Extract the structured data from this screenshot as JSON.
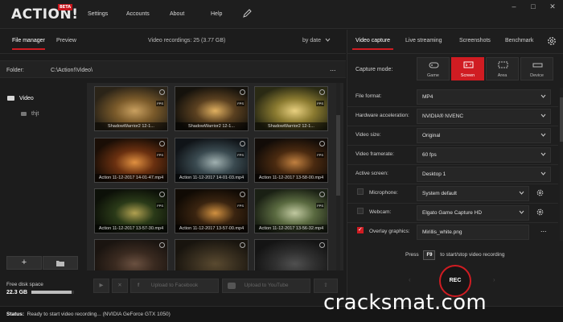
{
  "app": {
    "logo_text": "ACTION!",
    "beta_badge": "BETA",
    "menu": [
      "Settings",
      "Accounts",
      "About",
      "Help"
    ]
  },
  "left": {
    "tabs": [
      "File manager",
      "Preview"
    ],
    "active_tab": "File manager",
    "recordings_info": "Video recordings: 25 (3.77 GB)",
    "sort_label": "by date",
    "folder_label": "Folder:",
    "folder_path": "C:\\Action!\\Video\\",
    "folder_more": "...",
    "tree": [
      {
        "label": "Video",
        "level": 0
      },
      {
        "label": "thjt",
        "level": 1
      }
    ],
    "tree_add_button": "+",
    "disk_label": "Free disk space",
    "disk_value": "22.3 GB",
    "disk_fraction": 0.95,
    "thumbnails": [
      {
        "caption": "ShadowWarrior2 12-1...",
        "fps": "FPS",
        "colors": [
          "#2b2418",
          "#7a5a2a",
          "#c9a060"
        ]
      },
      {
        "caption": "ShadowWarrior2 12-1...",
        "fps": "FPS",
        "colors": [
          "#15120c",
          "#5a4020",
          "#e0b060"
        ]
      },
      {
        "caption": "ShadowWarrior2 12-1...",
        "fps": "FPS",
        "colors": [
          "#2a2a14",
          "#8a7a30",
          "#e8d080"
        ]
      },
      {
        "caption": "Action 11-12-2017 14-01-47.mp4",
        "fps": "FPS",
        "colors": [
          "#1a0e06",
          "#6a3010",
          "#e09040"
        ]
      },
      {
        "caption": "Action 11-12-2017 14-01-03.mp4",
        "fps": "FPS",
        "colors": [
          "#101418",
          "#3a4a50",
          "#a0b0b0"
        ]
      },
      {
        "caption": "Action 11-12-2017 13-58-00.mp4",
        "fps": "FPS",
        "colors": [
          "#120c08",
          "#4a2a10",
          "#c08040"
        ]
      },
      {
        "caption": "Action 11-12-2017 13-57-30.mp4",
        "fps": "FPS",
        "colors": [
          "#0c1008",
          "#2a3a18",
          "#b0a050"
        ]
      },
      {
        "caption": "Action 11-12-2017 13-57-00.mp4",
        "fps": "FPS",
        "colors": [
          "#100a04",
          "#3a2410",
          "#d09040"
        ]
      },
      {
        "caption": "Action 11-12-2017 13-56-32.mp4",
        "fps": "FPS",
        "colors": [
          "#1a2014",
          "#5a6a40",
          "#c0c8a0"
        ]
      },
      {
        "caption": "",
        "fps": "",
        "colors": [
          "#1a1410",
          "#3a2a20",
          "#6a5040"
        ]
      },
      {
        "caption": "",
        "fps": "",
        "colors": [
          "#18140e",
          "#3a3020",
          "#5a4a30"
        ]
      },
      {
        "caption": "",
        "fps": "",
        "colors": [
          "#141414",
          "#303030",
          "#505050"
        ]
      }
    ],
    "actions": {
      "play": "▶",
      "delete": "✕",
      "facebook_label": "Upload to Facebook",
      "youtube_label": "Upload to YouTube",
      "upload_icon": "⇪"
    }
  },
  "right": {
    "tabs": [
      "Video capture",
      "Live streaming",
      "Screenshots",
      "Benchmark"
    ],
    "active_tab": "Video capture",
    "capture_mode_label": "Capture mode:",
    "modes": [
      {
        "label": "Game",
        "icon": "gamepad-icon"
      },
      {
        "label": "Screen",
        "icon": "screen-icon"
      },
      {
        "label": "Area",
        "icon": "area-icon"
      },
      {
        "label": "Device",
        "icon": "device-icon"
      }
    ],
    "active_mode": "Screen",
    "settings": {
      "file_format": {
        "label": "File format:",
        "value": "MP4"
      },
      "hw_accel": {
        "label": "Hardware acceleration:",
        "value": "NVIDIA® NVENC"
      },
      "video_size": {
        "label": "Video size:",
        "value": "Original"
      },
      "framerate": {
        "label": "Video framerate:",
        "value": "60 fps"
      },
      "active_screen": {
        "label": "Active screen:",
        "value": "Desktop 1"
      },
      "microphone": {
        "label": "Microphone:",
        "value": "System default",
        "checked": false
      },
      "webcam": {
        "label": "Webcam:",
        "value": "Elgato Game Capture HD",
        "checked": false
      },
      "overlay": {
        "label": "Overlay graphics:",
        "value": "Mirillis_white.png",
        "checked": true,
        "more": "..."
      }
    },
    "hotkey": {
      "prefix": "Press",
      "key": "F9",
      "suffix": "to start/stop video recording"
    },
    "rec_label": "REC"
  },
  "status": {
    "label": "Status:",
    "text": "Ready to start video recording... (NVIDIA GeForce GTX 1050)"
  },
  "watermark": "cracksmat.com",
  "colors": {
    "accent": "#d01c22",
    "bg": "#1b1b1b"
  }
}
